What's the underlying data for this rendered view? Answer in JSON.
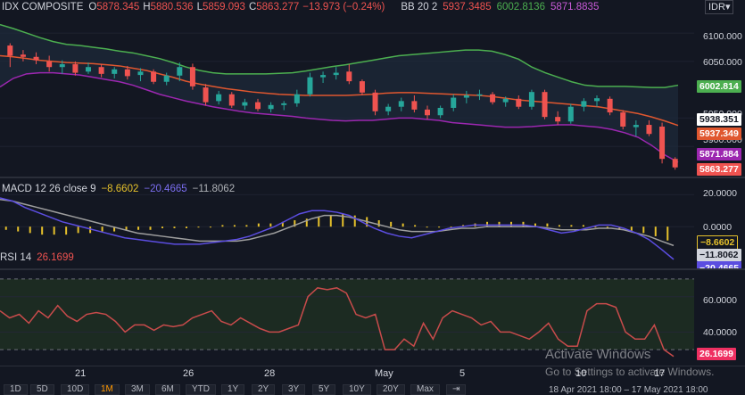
{
  "main_legend": {
    "symbol": "IDX COMPOSITE",
    "open_label": "O",
    "open": "5878.345",
    "high_label": "H",
    "high": "5880.536",
    "low_label": "L",
    "low": "5859.093",
    "close_label": "C",
    "close": "5863.277",
    "change": "−13.973 (−0.24%)",
    "bb_label": "BB 20 2",
    "bb_basis": "5937.3485",
    "bb_upper": "6002.8136",
    "bb_lower": "5871.8835"
  },
  "currency_button": "IDR▾",
  "price_axis": {
    "ticks": [
      "6100.000",
      "6050.000",
      "5950.000",
      "5900.000"
    ]
  },
  "price_tags": {
    "bb_upper": "6002.814",
    "last_close_a": "5938.351",
    "bb_basis": "5937.349",
    "bb_lower": "5871.884",
    "last_close": "5863.277"
  },
  "macd_legend": {
    "label": "MACD 12 26 close 9",
    "hist": "−8.6602",
    "macd": "−20.4665",
    "signal": "−11.8062"
  },
  "macd_axis": {
    "ticks": [
      "20.0000",
      "0.0000"
    ],
    "tag_hist": "−8.6602",
    "tag_signal": "−11.8062",
    "tag_macd": "−20.4665"
  },
  "rsi_legend": {
    "label": "RSI 14",
    "value": "26.1699"
  },
  "rsi_axis": {
    "ticks": [
      "60.0000",
      "40.0000"
    ],
    "tag": "26.1699"
  },
  "x_axis": {
    "labels": [
      "21",
      "26",
      "28",
      "May",
      "5",
      "10",
      "17"
    ]
  },
  "timeframes": [
    "1D",
    "5D",
    "10D",
    "1M",
    "3M",
    "6M",
    "YTD",
    "1Y",
    "2Y",
    "3Y",
    "5Y",
    "10Y",
    "20Y",
    "Max"
  ],
  "selected_timeframe": "1M",
  "date_range": "18 Apr 2021 18:00 – 17 May 2021 18:00",
  "watermark": {
    "title": "Activate Windows",
    "subtitle": "Go to Settings to activate Windows."
  },
  "colors": {
    "background": "#131722",
    "up": "#26a69a",
    "down": "#ef5350",
    "bb_upper": "#4caf50",
    "bb_basis": "#e0572f",
    "bb_lower": "#9c27b0",
    "macd": "#5b4de0",
    "signal": "#9e9e9e",
    "hist": "#e6c12b",
    "rsi": "#c84b4b",
    "rsi_band": "#1c2b22"
  },
  "chart_data": [
    {
      "type": "candlestick",
      "title": "IDX COMPOSITE",
      "ylim": [
        5850,
        6130
      ],
      "x_labels": [
        "21",
        "26",
        "28",
        "May",
        "5",
        "10",
        "17"
      ],
      "candles": [
        {
          "o": 6078,
          "h": 6082,
          "l": 6040,
          "c": 6060
        },
        {
          "o": 6062,
          "h": 6070,
          "l": 6050,
          "c": 6058
        },
        {
          "o": 6058,
          "h": 6066,
          "l": 6045,
          "c": 6052
        },
        {
          "o": 6050,
          "h": 6060,
          "l": 6032,
          "c": 6040
        },
        {
          "o": 6040,
          "h": 6052,
          "l": 6028,
          "c": 6045
        },
        {
          "o": 6045,
          "h": 6050,
          "l": 6025,
          "c": 6030
        },
        {
          "o": 6032,
          "h": 6048,
          "l": 6028,
          "c": 6040
        },
        {
          "o": 6040,
          "h": 6045,
          "l": 6022,
          "c": 6028
        },
        {
          "o": 6028,
          "h": 6040,
          "l": 6020,
          "c": 6036
        },
        {
          "o": 6036,
          "h": 6042,
          "l": 6018,
          "c": 6024
        },
        {
          "o": 6026,
          "h": 6038,
          "l": 6015,
          "c": 6032
        },
        {
          "o": 6032,
          "h": 6036,
          "l": 6010,
          "c": 6014
        },
        {
          "o": 6014,
          "h": 6030,
          "l": 6008,
          "c": 6025
        },
        {
          "o": 6025,
          "h": 6048,
          "l": 6015,
          "c": 6040
        },
        {
          "o": 6040,
          "h": 6046,
          "l": 6000,
          "c": 6006
        },
        {
          "o": 6004,
          "h": 6010,
          "l": 5972,
          "c": 5978
        },
        {
          "o": 5980,
          "h": 5998,
          "l": 5974,
          "c": 5992
        },
        {
          "o": 5992,
          "h": 5996,
          "l": 5968,
          "c": 5972
        },
        {
          "o": 5972,
          "h": 5984,
          "l": 5965,
          "c": 5978
        },
        {
          "o": 5978,
          "h": 5984,
          "l": 5962,
          "c": 5966
        },
        {
          "o": 5966,
          "h": 5978,
          "l": 5960,
          "c": 5973
        },
        {
          "o": 5973,
          "h": 5980,
          "l": 5964,
          "c": 5976
        },
        {
          "o": 5976,
          "h": 6000,
          "l": 5970,
          "c": 5992
        },
        {
          "o": 5992,
          "h": 6030,
          "l": 5988,
          "c": 6022
        },
        {
          "o": 6022,
          "h": 6032,
          "l": 6012,
          "c": 6026
        },
        {
          "o": 6026,
          "h": 6040,
          "l": 6018,
          "c": 6030
        },
        {
          "o": 6032,
          "h": 6045,
          "l": 6010,
          "c": 6015
        },
        {
          "o": 6015,
          "h": 6018,
          "l": 5990,
          "c": 5995
        },
        {
          "o": 5995,
          "h": 6000,
          "l": 5955,
          "c": 5962
        },
        {
          "o": 5962,
          "h": 5975,
          "l": 5955,
          "c": 5970
        },
        {
          "o": 5970,
          "h": 5986,
          "l": 5962,
          "c": 5980
        },
        {
          "o": 5980,
          "h": 5990,
          "l": 5960,
          "c": 5965
        },
        {
          "o": 5965,
          "h": 5972,
          "l": 5948,
          "c": 5955
        },
        {
          "o": 5955,
          "h": 5972,
          "l": 5950,
          "c": 5968
        },
        {
          "o": 5968,
          "h": 5992,
          "l": 5962,
          "c": 5986
        },
        {
          "o": 5986,
          "h": 5998,
          "l": 5976,
          "c": 5990
        },
        {
          "o": 5990,
          "h": 6000,
          "l": 5982,
          "c": 5992
        },
        {
          "o": 5992,
          "h": 5996,
          "l": 5974,
          "c": 5978
        },
        {
          "o": 5978,
          "h": 5988,
          "l": 5970,
          "c": 5984
        },
        {
          "o": 5984,
          "h": 5990,
          "l": 5966,
          "c": 5970
        },
        {
          "o": 5970,
          "h": 6000,
          "l": 5965,
          "c": 5996
        },
        {
          "o": 5996,
          "h": 6000,
          "l": 5948,
          "c": 5952
        },
        {
          "o": 5952,
          "h": 5962,
          "l": 5938,
          "c": 5944
        },
        {
          "o": 5944,
          "h": 5975,
          "l": 5940,
          "c": 5970
        },
        {
          "o": 5970,
          "h": 5985,
          "l": 5962,
          "c": 5980
        },
        {
          "o": 5980,
          "h": 5990,
          "l": 5970,
          "c": 5985
        },
        {
          "o": 5984,
          "h": 5988,
          "l": 5955,
          "c": 5960
        },
        {
          "o": 5960,
          "h": 5964,
          "l": 5930,
          "c": 5935
        },
        {
          "o": 5934,
          "h": 5946,
          "l": 5918,
          "c": 5938
        },
        {
          "o": 5938,
          "h": 5946,
          "l": 5918,
          "c": 5922
        },
        {
          "o": 5935,
          "h": 5942,
          "l": 5870,
          "c": 5878
        },
        {
          "o": 5878,
          "h": 5881,
          "l": 5859,
          "c": 5863
        }
      ],
      "series": [
        {
          "name": "BB upper",
          "values": [
            6115,
            6108,
            6100,
            6092,
            6085,
            6080,
            6078,
            6075,
            6072,
            6068,
            6065,
            6060,
            6055,
            6048,
            6040,
            6034,
            6030,
            6028,
            6028,
            6028,
            6028,
            6029,
            6030,
            6033,
            6037,
            6041,
            6044,
            6048,
            6052,
            6056,
            6060,
            6062,
            6064,
            6066,
            6068,
            6070,
            6070,
            6068,
            6062,
            6054,
            6040,
            6030,
            6022,
            6014,
            6008,
            6006,
            6006,
            6006,
            6005,
            6004,
            6004,
            6008
          ]
        },
        {
          "name": "BB basis",
          "values": [
            6060,
            6058,
            6055,
            6052,
            6050,
            6048,
            6047,
            6046,
            6044,
            6042,
            6038,
            6034,
            6028,
            6022,
            6015,
            6010,
            6006,
            6002,
            5999,
            5996,
            5994,
            5992,
            5991,
            5990,
            5990,
            5990,
            5990,
            5991,
            5992,
            5994,
            5995,
            5995,
            5994,
            5993,
            5992,
            5991,
            5990,
            5988,
            5985,
            5982,
            5980,
            5978,
            5976,
            5974,
            5972,
            5970,
            5966,
            5962,
            5958,
            5952,
            5945,
            5937
          ]
        },
        {
          "name": "BB lower",
          "values": [
            6005,
            6020,
            6028,
            6030,
            6030,
            6028,
            6026,
            6022,
            6018,
            6014,
            6008,
            6000,
            5992,
            5986,
            5980,
            5975,
            5970,
            5966,
            5962,
            5959,
            5957,
            5955,
            5953,
            5950,
            5948,
            5946,
            5945,
            5946,
            5946,
            5948,
            5950,
            5950,
            5948,
            5946,
            5942,
            5940,
            5938,
            5936,
            5934,
            5934,
            5935,
            5937,
            5938,
            5938,
            5936,
            5934,
            5930,
            5924,
            5916,
            5902,
            5885,
            5872
          ]
        }
      ]
    },
    {
      "type": "bar",
      "title": "MACD 12 26 close 9",
      "ylim": [
        -25,
        28
      ],
      "series": [
        {
          "name": "histogram",
          "values": [
            -2,
            -3,
            -4,
            -5,
            -5,
            -5,
            -4,
            -4,
            -3,
            -3,
            -2,
            -2,
            -2,
            -1,
            -1,
            -1,
            0,
            0,
            1,
            1,
            1,
            2,
            2,
            3,
            4,
            5,
            6,
            7,
            8,
            7,
            6,
            4,
            3,
            2,
            1,
            0,
            0,
            0,
            1,
            2,
            3,
            3,
            3,
            3,
            2,
            2,
            1,
            1,
            1,
            0,
            -1,
            -2,
            -3,
            -4,
            -6,
            -8.66
          ]
        },
        {
          "name": "macd",
          "values": [
            18,
            16,
            12,
            9,
            6,
            3,
            1,
            -1,
            -3,
            -5,
            -7,
            -8,
            -9,
            -10,
            -11,
            -11,
            -11,
            -10,
            -9,
            -8,
            -6,
            -3,
            0,
            4,
            8,
            10,
            10,
            9,
            7,
            3,
            -1,
            -4,
            -6,
            -7,
            -5,
            -3,
            -1,
            0,
            1,
            1,
            1,
            1,
            1,
            0,
            -2,
            -4,
            -3,
            -1,
            1,
            1,
            -1,
            -4,
            -8,
            -14,
            -20.47
          ]
        },
        {
          "name": "signal",
          "values": [
            17,
            16,
            14,
            12,
            10,
            8,
            6,
            4,
            2,
            0,
            -2,
            -4,
            -5,
            -6,
            -7,
            -8,
            -9,
            -9,
            -9,
            -9,
            -8,
            -6,
            -4,
            -1,
            2,
            5,
            7,
            7,
            6,
            4,
            2,
            0,
            -2,
            -3,
            -3,
            -3,
            -2,
            -1,
            -1,
            0,
            0,
            0,
            0,
            0,
            -1,
            -2,
            -2,
            -2,
            -1,
            -1,
            -2,
            -4,
            -6,
            -9,
            -11.81
          ]
        }
      ]
    },
    {
      "type": "line",
      "title": "RSI 14",
      "ylim": [
        22,
        74
      ],
      "levels": [
        70,
        30
      ],
      "series": [
        {
          "name": "RSI",
          "values": [
            52,
            48,
            50,
            45,
            52,
            48,
            55,
            49,
            46,
            50,
            51,
            50,
            46,
            40,
            44,
            44,
            41,
            44,
            43,
            44,
            48,
            50,
            52,
            46,
            44,
            48,
            45,
            42,
            40,
            40,
            42,
            44,
            60,
            65,
            64,
            65,
            62,
            50,
            48,
            50,
            30,
            30,
            36,
            32,
            45,
            36,
            48,
            52,
            50,
            48,
            44,
            46,
            40,
            40,
            38,
            36,
            40,
            45,
            36,
            32,
            32,
            52,
            56,
            56,
            54,
            40,
            36,
            36,
            44,
            30,
            26.17
          ]
        }
      ]
    }
  ]
}
